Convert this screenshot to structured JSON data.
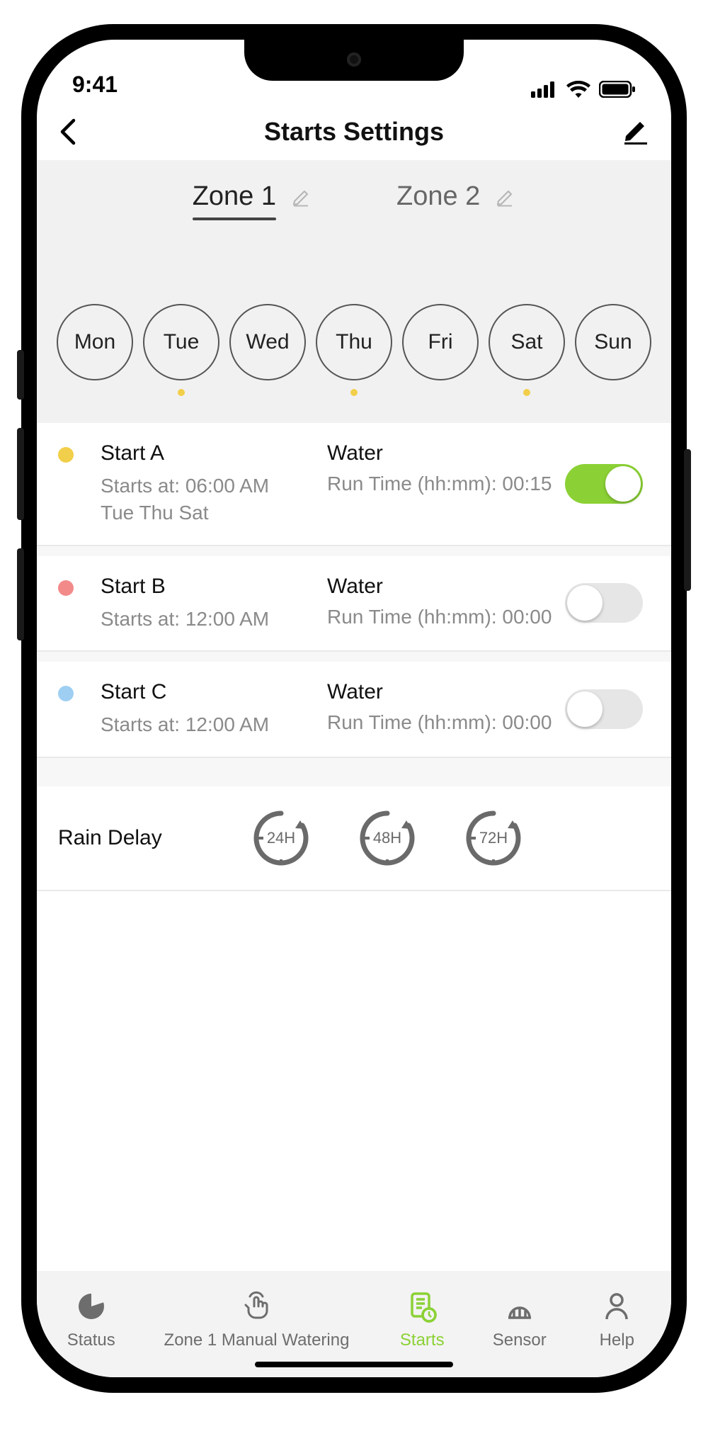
{
  "statusbar": {
    "time": "9:41"
  },
  "header": {
    "title": "Starts Settings"
  },
  "zones": {
    "active_index": 0,
    "items": [
      {
        "label": "Zone 1"
      },
      {
        "label": "Zone 2"
      }
    ]
  },
  "days": [
    {
      "short": "Mon",
      "scheduled": false
    },
    {
      "short": "Tue",
      "scheduled": true
    },
    {
      "short": "Wed",
      "scheduled": false
    },
    {
      "short": "Thu",
      "scheduled": true
    },
    {
      "short": "Fri",
      "scheduled": false
    },
    {
      "short": "Sat",
      "scheduled": true
    },
    {
      "short": "Sun",
      "scheduled": false
    }
  ],
  "starts": [
    {
      "name": "Start A",
      "dot_color": "#f2cf4a",
      "starts_at_label": "Starts at: 06:00 AM",
      "days_label": "Tue Thu Sat",
      "mode_label": "Water",
      "runtime_label": "Run Time (hh:mm): 00:15",
      "enabled": true
    },
    {
      "name": "Start B",
      "dot_color": "#f28a8a",
      "starts_at_label": "Starts at: 12:00 AM",
      "days_label": "",
      "mode_label": "Water",
      "runtime_label": "Run Time (hh:mm): 00:00",
      "enabled": false
    },
    {
      "name": "Start C",
      "dot_color": "#9ecff2",
      "starts_at_label": "Starts at: 12:00 AM",
      "days_label": "",
      "mode_label": "Water",
      "runtime_label": "Run Time (hh:mm): 00:00",
      "enabled": false
    }
  ],
  "rain_delay": {
    "label": "Rain Delay",
    "options": [
      "24H",
      "48H",
      "72H"
    ]
  },
  "tabs": {
    "active_index": 2,
    "items": [
      {
        "label": "Status"
      },
      {
        "label": "Zone 1 Manual Watering"
      },
      {
        "label": "Starts"
      },
      {
        "label": "Sensor"
      },
      {
        "label": "Help"
      }
    ]
  },
  "colors": {
    "accent": "#8bd135"
  }
}
